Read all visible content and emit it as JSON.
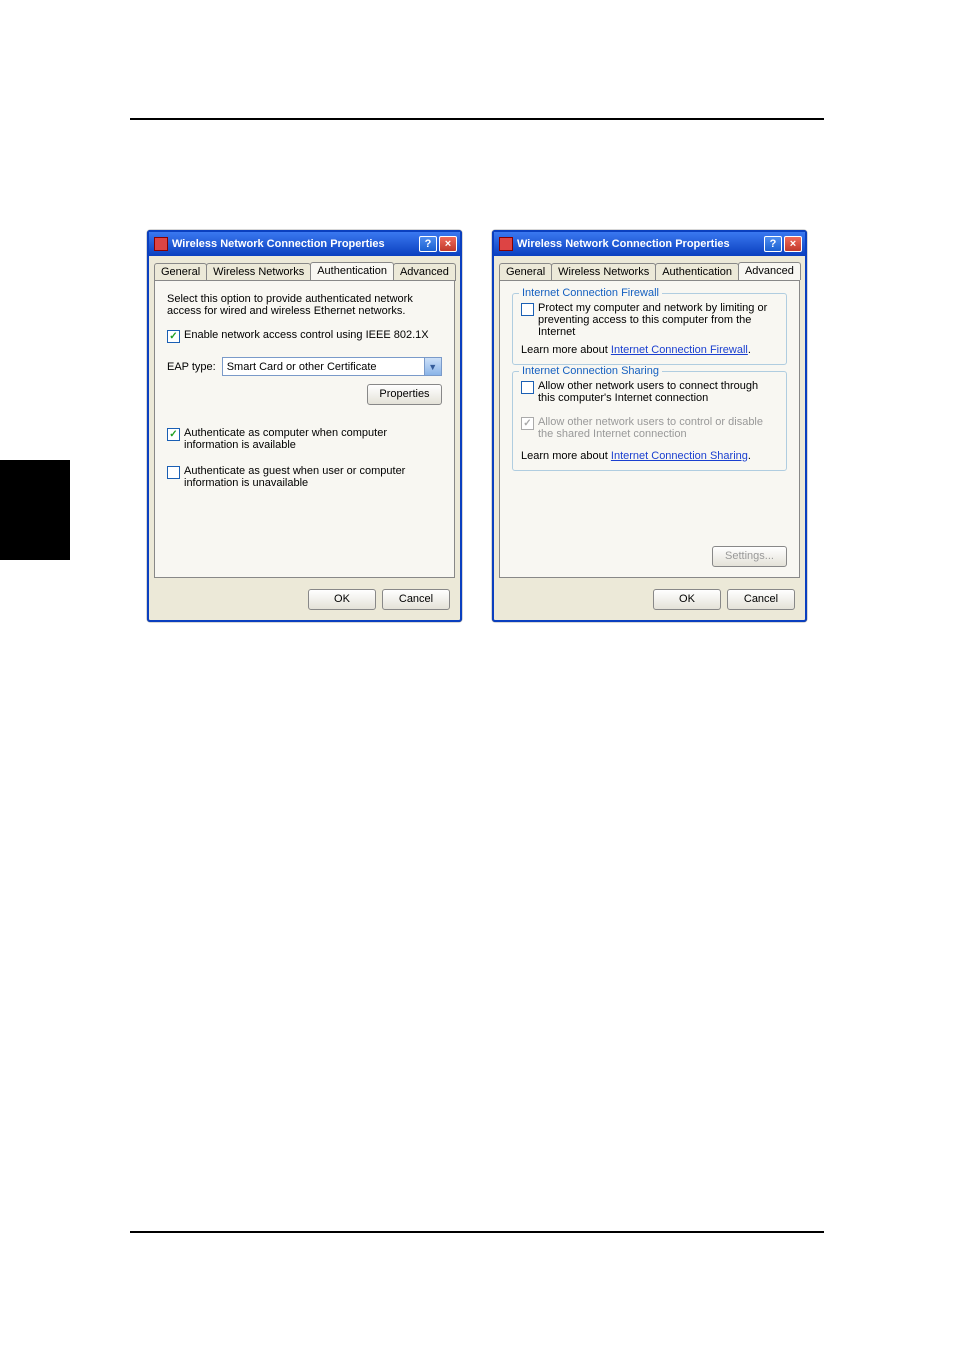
{
  "dialog_title": "Wireless Network Connection Properties",
  "tabs": {
    "general": "General",
    "wireless": "Wireless Networks",
    "authentication": "Authentication",
    "advanced": "Advanced"
  },
  "auth": {
    "intro": "Select this option to provide authenticated network access for wired and wireless Ethernet networks.",
    "enable_8021x": "Enable network access control using IEEE 802.1X",
    "eap_label": "EAP type:",
    "eap_value": "Smart Card or other Certificate",
    "properties_btn": "Properties",
    "auth_as_computer": "Authenticate as computer when computer information is available",
    "auth_as_guest": "Authenticate as guest when user or computer information is unavailable"
  },
  "adv": {
    "icf_legend": "Internet Connection Firewall",
    "icf_check": "Protect my computer and network by limiting or preventing access to this computer from the Internet",
    "icf_learn_pre": "Learn more about ",
    "icf_learn_link": "Internet Connection Firewall",
    "ics_legend": "Internet Connection Sharing",
    "ics_allow_connect": "Allow other network users to connect through this computer's Internet connection",
    "ics_allow_control": "Allow other network users to control or disable the shared Internet connection",
    "ics_learn_pre": "Learn more about ",
    "ics_learn_link": "Internet Connection Sharing",
    "settings_btn": "Settings..."
  },
  "buttons": {
    "ok": "OK",
    "cancel": "Cancel"
  },
  "titlebar_help": "?",
  "titlebar_close": "×"
}
